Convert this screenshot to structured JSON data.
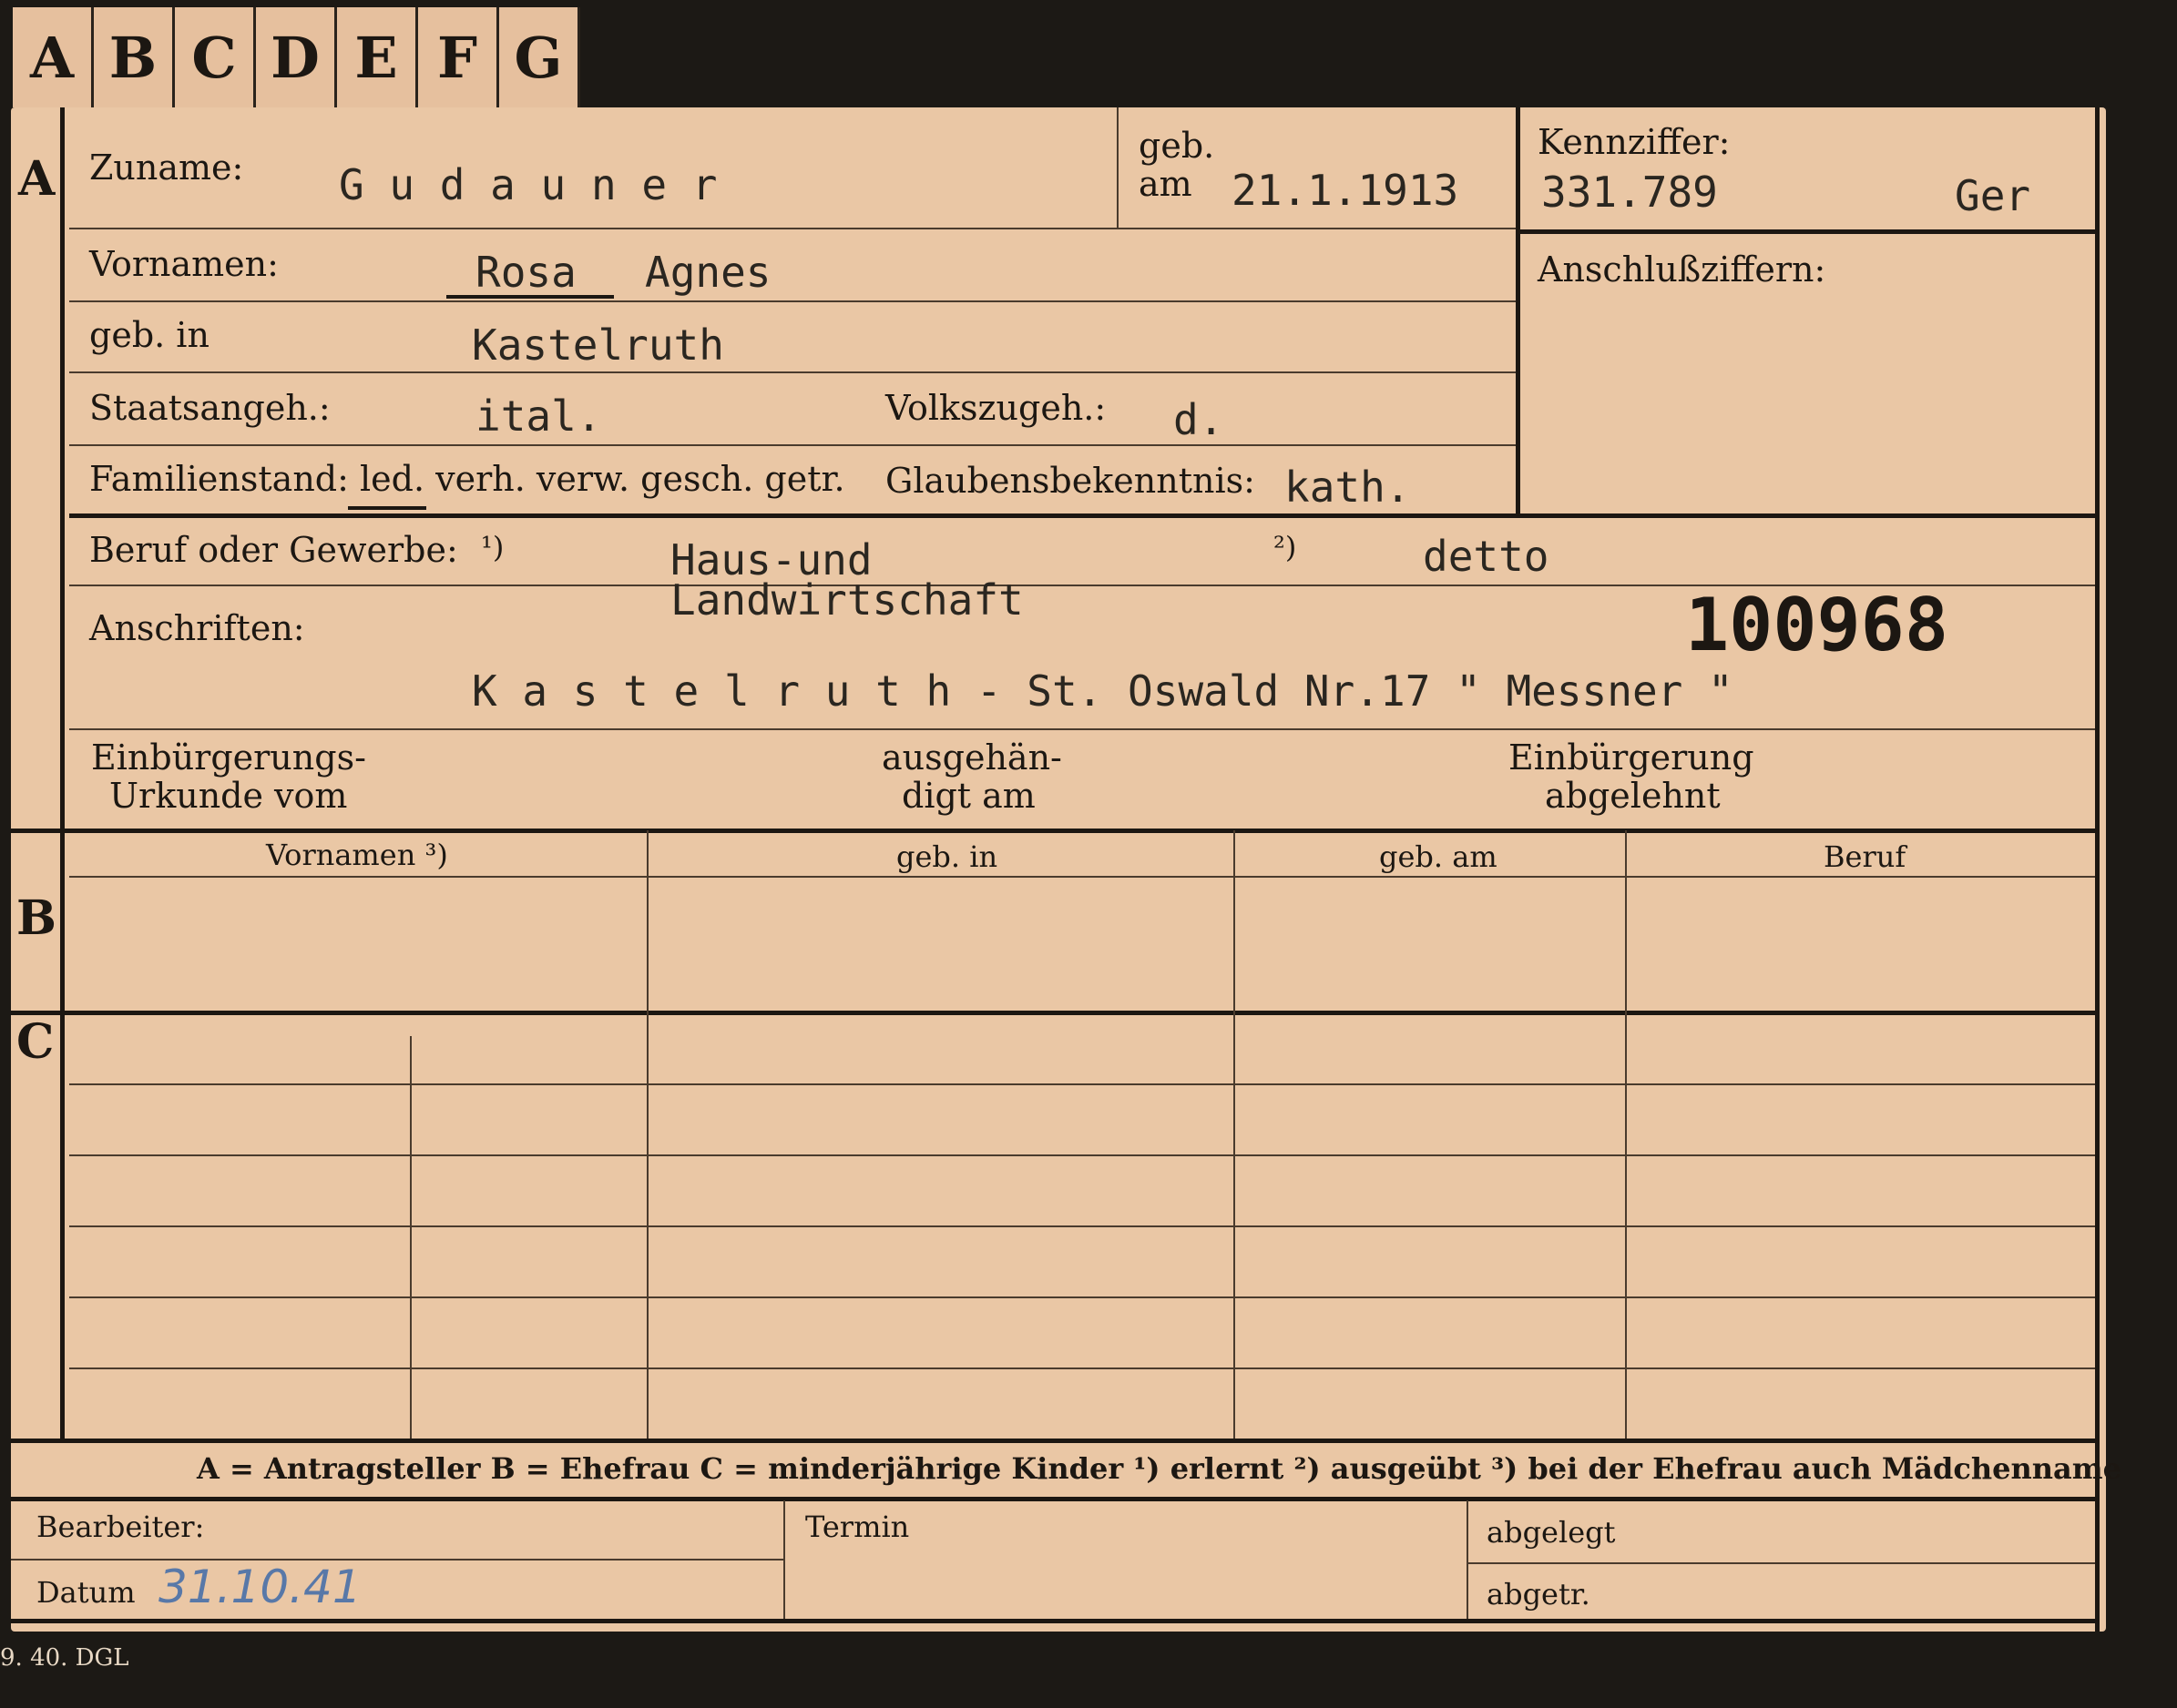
{
  "tabs": [
    "A",
    "B",
    "C",
    "D",
    "E",
    "F",
    "G"
  ],
  "sections": {
    "a": "A",
    "b": "B",
    "c": "C"
  },
  "labels": {
    "zuname": "Zuname:",
    "geb_am_1": "geb.",
    "geb_am_2": "am",
    "kennziffer": "Kennziffer:",
    "vornamen": "Vornamen:",
    "anschlussziffern": "Anschlußziffern:",
    "geb_in": "geb. in",
    "staatsangeh": "Staatsangeh.:",
    "volkszugeh": "Volkszugeh.:",
    "familienstand": "Familienstand: led. verh. verw. gesch. getr.",
    "glaubensbekenntnis": "Glaubensbekenntnis:",
    "beruf": "Beruf oder Gewerbe:",
    "fn1": "¹)",
    "fn2": "²)",
    "anschriften": "Anschriften:",
    "einb_urkunde_1": "Einbürgerungs-",
    "einb_urkunde_2": "Urkunde vom",
    "ausgehaendigt_1": "ausgehän-",
    "ausgehaendigt_2": "digt am",
    "einb_abgelehnt_1": "Einbürgerung",
    "einb_abgelehnt_2": "abgelehnt",
    "col_vornamen": "Vornamen ³)",
    "col_geb_in": "geb. in",
    "col_geb_am": "geb. am",
    "col_beruf": "Beruf",
    "bearbeiter": "Bearbeiter:",
    "datum": "Datum",
    "termin": "Termin",
    "abgelegt": "abgelegt",
    "abgetr": "abgetr."
  },
  "values": {
    "zuname": "G u d a u n e r",
    "geb_am": "21.1.1913",
    "kennziffer": "331.789",
    "kennziffer_code": "Ger",
    "vorname_1": "Rosa",
    "vorname_2": "Agnes",
    "geb_in": "Kastelruth",
    "staatsangeh": "ital.",
    "volkszugeh": "d.",
    "glaubensbekenntnis": "kath.",
    "beruf_erlernt_1": "Haus-und",
    "beruf_erlernt_2": "Landwirtschaft",
    "beruf_ausgeuebt": "detto",
    "anschrift": "K a s t e l r u t h  - St. Oswald Nr.17 \" Messner \"",
    "stamp_number": "100968",
    "datum": "31.10.41"
  },
  "footer_legend": "A = Antragsteller   B = Ehefrau   C = minderjährige Kinder   ¹) erlernt   ²) ausgeübt   ³) bei der Ehefrau auch Mädchenname",
  "print_mark": "9. 40. DGL"
}
